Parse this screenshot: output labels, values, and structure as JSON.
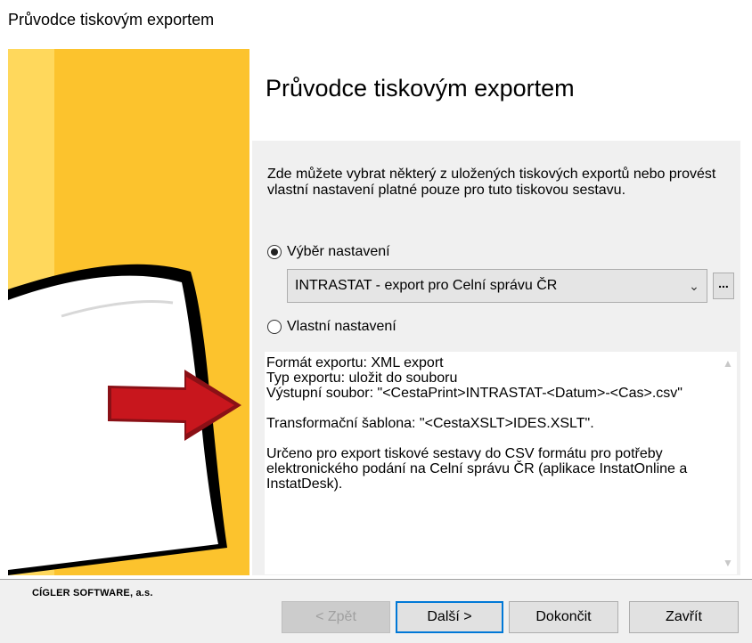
{
  "window": {
    "title": "Průvodce tiskovým exportem"
  },
  "wizard": {
    "heading": "Průvodce tiskovým exportem",
    "intro": "Zde můžete vybrat některý z uložených tiskových exportů nebo provést vlastní nastavení platné pouze pro tuto tiskovou sestavu."
  },
  "options": {
    "preset_label": "Výběr nastavení",
    "preset_checked": true,
    "preset_value": "INTRASTAT - export pro Celní správu ČR",
    "ellipsis_label": "...",
    "custom_label": "Vlastní nastavení",
    "custom_checked": false
  },
  "description": {
    "format": "Formát exportu: XML export",
    "type": "Typ exportu: uložit do souboru",
    "output": "Výstupní soubor:  \"<CestaPrint>INTRASTAT-<Datum>-<Cas>.csv\"",
    "template": "Transformační šablona: \"<CestaXSLT>IDES.XSLT\".",
    "purpose": "Určeno pro export tiskové sestavy do CSV formátu pro potřeby elektronického podání na Celní správu ČR (aplikace InstatOnline a InstatDesk)."
  },
  "footer": {
    "company": "CÍGLER SOFTWARE, a.s.",
    "back": "< Zpět",
    "next": "Další >",
    "finish": "Dokončit",
    "close": "Zavřít"
  },
  "colors": {
    "side_yellow": "#fcc32d",
    "arrow_red": "#c8161d",
    "accent": "#0078d7"
  },
  "icons": {
    "combo": "chevron-down-icon",
    "scroll_up": "chevron-up-icon",
    "scroll_down": "chevron-down-icon"
  }
}
